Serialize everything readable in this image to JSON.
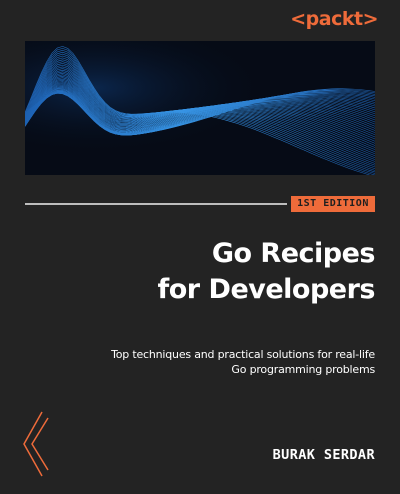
{
  "publisher": {
    "logo_text": "<packt>"
  },
  "edition": {
    "label": "1ST EDITION"
  },
  "book": {
    "title_line1": "Go Recipes",
    "title_line2": "for Developers",
    "subtitle_line1": "Top techniques and practical solutions for real-life",
    "subtitle_line2": "Go programming problems",
    "author": "BURAK SERDAR"
  },
  "colors": {
    "background": "#232323",
    "accent": "#ee6b3a",
    "wave": "#2f8fe0",
    "art_background": "#060b16"
  },
  "icons": {
    "cover_art": "abstract-wave-lines",
    "corner_mark": "chevron-lines-icon"
  }
}
